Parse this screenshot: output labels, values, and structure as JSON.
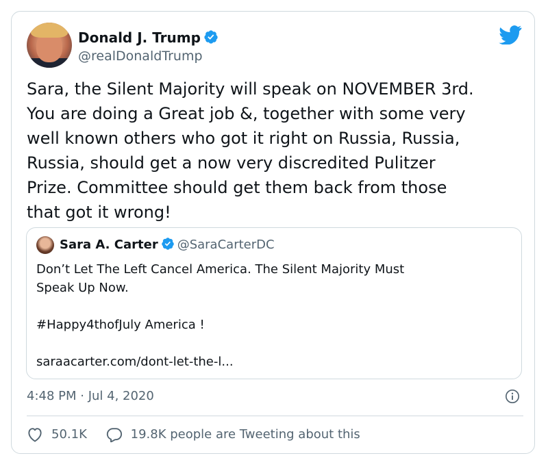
{
  "tweet": {
    "author": {
      "name": "Donald J. Trump",
      "handle": "@realDonaldTrump",
      "verified": true
    },
    "text": "Sara, the Silent Majority will speak on NOVEMBER 3rd.\nYou are doing a Great job &, together with some very\nwell known others who got it right on Russia, Russia,\nRussia, should get a now very discredited Pulitzer\nPrize. Committee should get them back from those\nthat got it wrong!",
    "quoted": {
      "name": "Sara A. Carter",
      "handle": "@SaraCarterDC",
      "verified": true,
      "line1": "Don’t Let The Left Cancel America. The Silent Majority Must",
      "line2": "Speak Up Now.",
      "hashtag_line": "#Happy4thofJuly America !",
      "link": "saraacarter.com/dont-let-the-l..."
    },
    "timestamp": "4:48 PM · Jul 4, 2020",
    "likes": "50.1K",
    "tweeting_text": "19.8K people are Tweeting about this"
  },
  "colors": {
    "text": "#0f1419",
    "secondary": "#536471",
    "border": "#cfd9de",
    "brand": "#1d9bf0"
  },
  "icons": {
    "logo": "twitter-bird-icon",
    "verified": "verified-badge-icon",
    "info": "info-icon",
    "like": "heart-icon",
    "reply": "speech-bubble-icon"
  }
}
